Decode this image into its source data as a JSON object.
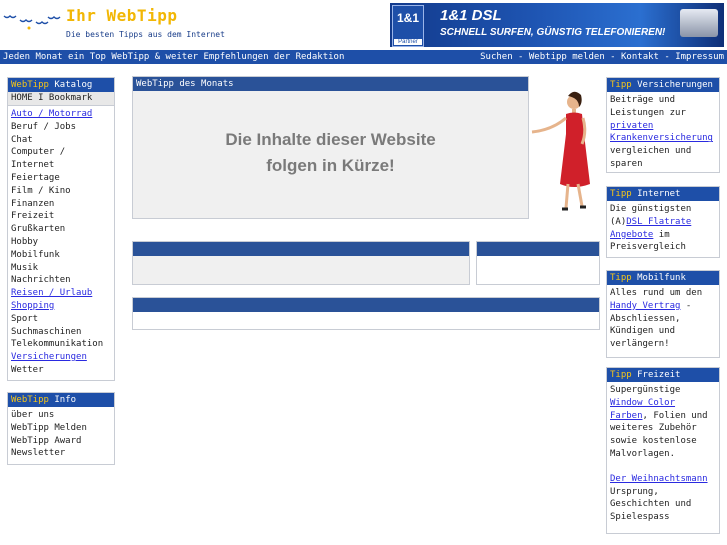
{
  "header": {
    "title": "Ihr WebTipp",
    "subtitle": "Die besten Tipps aus dem Internet"
  },
  "banner": {
    "logo": "1&1",
    "partner": "Partner",
    "headline": "1&1 DSL",
    "text": "SCHNELL SURFEN, GÜNSTIG TELEFONIEREN!"
  },
  "navbar": {
    "tagline": "Jeden Monat ein Top WebTipp & weiter Empfehlungen der Redaktion",
    "links": [
      "Suchen",
      "Webtipp melden",
      "Kontakt",
      "Impressum"
    ],
    "separator": " - "
  },
  "catalog": {
    "title_prefix": "WebTipp",
    "title": "Katalog",
    "home": "HOME I Bookmark",
    "items": [
      {
        "label": "Auto / Motorrad",
        "link": true
      },
      {
        "label": "Beruf / Jobs",
        "link": false
      },
      {
        "label": "Chat",
        "link": false
      },
      {
        "label": "Computer /",
        "link": false
      },
      {
        "label": "Internet",
        "link": false
      },
      {
        "label": "Feiertage",
        "link": false
      },
      {
        "label": "Film / Kino",
        "link": false
      },
      {
        "label": "Finanzen",
        "link": false
      },
      {
        "label": "Freizeit",
        "link": false
      },
      {
        "label": "Grußkarten",
        "link": false
      },
      {
        "label": "Hobby",
        "link": false
      },
      {
        "label": "Mobilfunk",
        "link": false
      },
      {
        "label": "Musik",
        "link": false
      },
      {
        "label": "Nachrichten",
        "link": false
      },
      {
        "label": "Reisen / Urlaub",
        "link": true
      },
      {
        "label": "Shopping",
        "link": true
      },
      {
        "label": "Sport",
        "link": false
      },
      {
        "label": "Suchmaschinen",
        "link": false
      },
      {
        "label": "Telekommunikation",
        "link": false
      },
      {
        "label": "Versicherungen",
        "link": true
      },
      {
        "label": "Wetter",
        "link": false
      }
    ]
  },
  "info": {
    "title_prefix": "WebTipp",
    "title": "Info",
    "items": [
      "über uns",
      "WebTipp Melden",
      "WebTipp Award",
      "Newsletter"
    ]
  },
  "main": {
    "month_title": "WebTipp des Monats",
    "soon_line1": "Die Inhalte dieser Website",
    "soon_line2": "folgen in Kürze!"
  },
  "right": {
    "versicherungen": {
      "title_prefix": "Tipp",
      "title": "Versicherungen",
      "text_before": "Beiträge und Leistungen zur",
      "link": "privaten Krankenversicherung",
      "text_after": "vergleichen und sparen"
    },
    "internet": {
      "title_prefix": "Tipp",
      "title": "Internet",
      "text_before": "Die günstigsten (A)",
      "link": "DSL Flatrate Angebote",
      "text_after": "im Preisvergleich"
    },
    "mobilfunk": {
      "title_prefix": "Tipp",
      "title": "Mobilfunk",
      "text_before": "Alles rund um den",
      "link": "Handy Vertrag",
      "text_after": "- Abschliessen, Kündigen und verlängern!"
    },
    "freizeit": {
      "title_prefix": "Tipp",
      "title": "Freizeit",
      "text_before": "Supergünstige",
      "link": "Window Color Farben",
      "text_after": ", Folien und weiteres Zubehör sowie kostenlose Malvorlagen.",
      "link2": "Der Weihnachtsmann",
      "text_after2": "Ursprung, Geschichten und Spielespass"
    }
  },
  "colors": {
    "navy": "#1e4fa8",
    "gold": "#f2b705",
    "link": "#2a2ae0"
  }
}
